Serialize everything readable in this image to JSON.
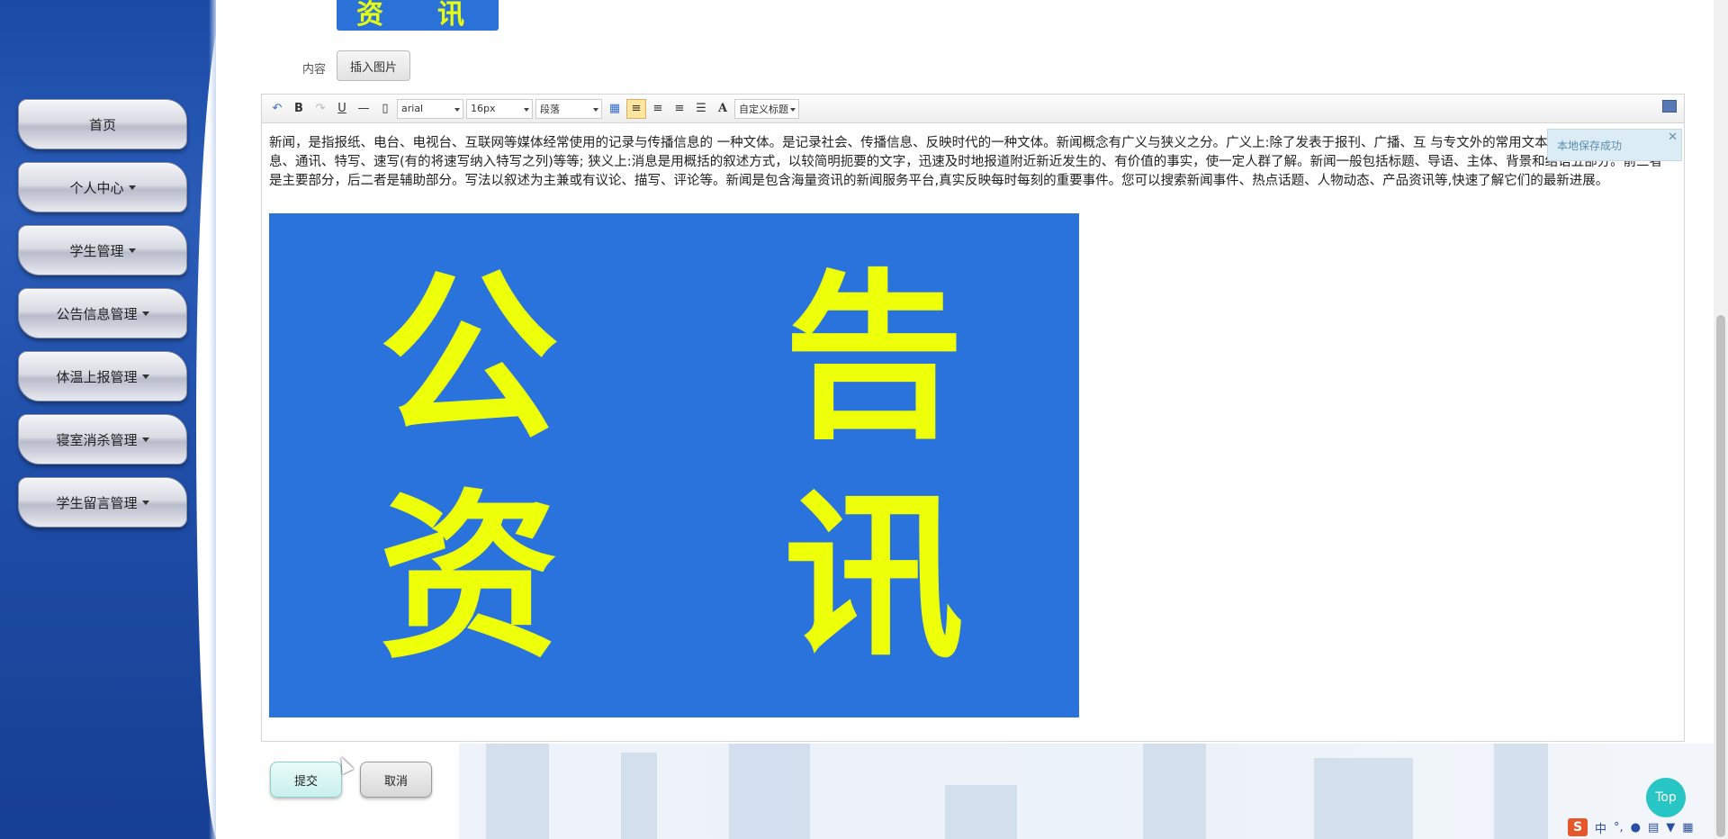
{
  "sidebar": {
    "items": [
      {
        "label": "首页",
        "dropdown": false
      },
      {
        "label": "个人中心",
        "dropdown": true
      },
      {
        "label": "学生管理",
        "dropdown": true
      },
      {
        "label": "公告信息管理",
        "dropdown": true
      },
      {
        "label": "体温上报管理",
        "dropdown": true
      },
      {
        "label": "寝室消杀管理",
        "dropdown": true
      },
      {
        "label": "学生留言管理",
        "dropdown": true
      }
    ]
  },
  "cover_image": {
    "chars": [
      "资",
      "讯"
    ]
  },
  "form": {
    "content_label": "内容",
    "insert_image_label": "插入图片",
    "submit_label": "提交",
    "cancel_label": "取消"
  },
  "editor": {
    "toolbar": {
      "font_family": "arial",
      "font_size": "16px",
      "paragraph": "段落",
      "custom_heading": "自定义标题"
    },
    "text": "新闻，是指报纸、电台、电视台、互联网等媒体经常使用的记录与传播信息的 一种文体。是记录社会、传播信息、反映时代的一种文体。新闻概念有广义与狭义之分。广义上:除了发表于报刊、广播、互 与专文外的常用文本都属于新闻，包括消息、通讯、特写、速写(有的将速写纳入特写之列)等等; 狭义上:消息是用概括的叙述方式，以较简明扼要的文字，迅速及时地报道附近新近发生的、有价值的事实，使一定人群了解。新闻一般包括标题、导语、主体、背景和结语五部分。前三者是主要部分，后二者是辅助部分。写法以叙述为主兼或有议论、描写、评论等。新闻是包含海量资讯的新闻服务平台,真实反映每时每刻的重要事件。您可以搜索新闻事件、热点话题、人物动态、产品资讯等,快速了解它们的最新进展。",
    "image_chars": [
      "公",
      "告",
      "资",
      "讯"
    ],
    "toast": "本地保存成功"
  },
  "top_button": "Top",
  "ime": {
    "logo": "S",
    "lang": "中",
    "punct": "°,"
  },
  "colors": {
    "sidebar": "#1f4ea8",
    "editor_image_bg": "#2a72dc",
    "editor_image_text": "#eeff0a",
    "top_button": "#27c5c4"
  }
}
